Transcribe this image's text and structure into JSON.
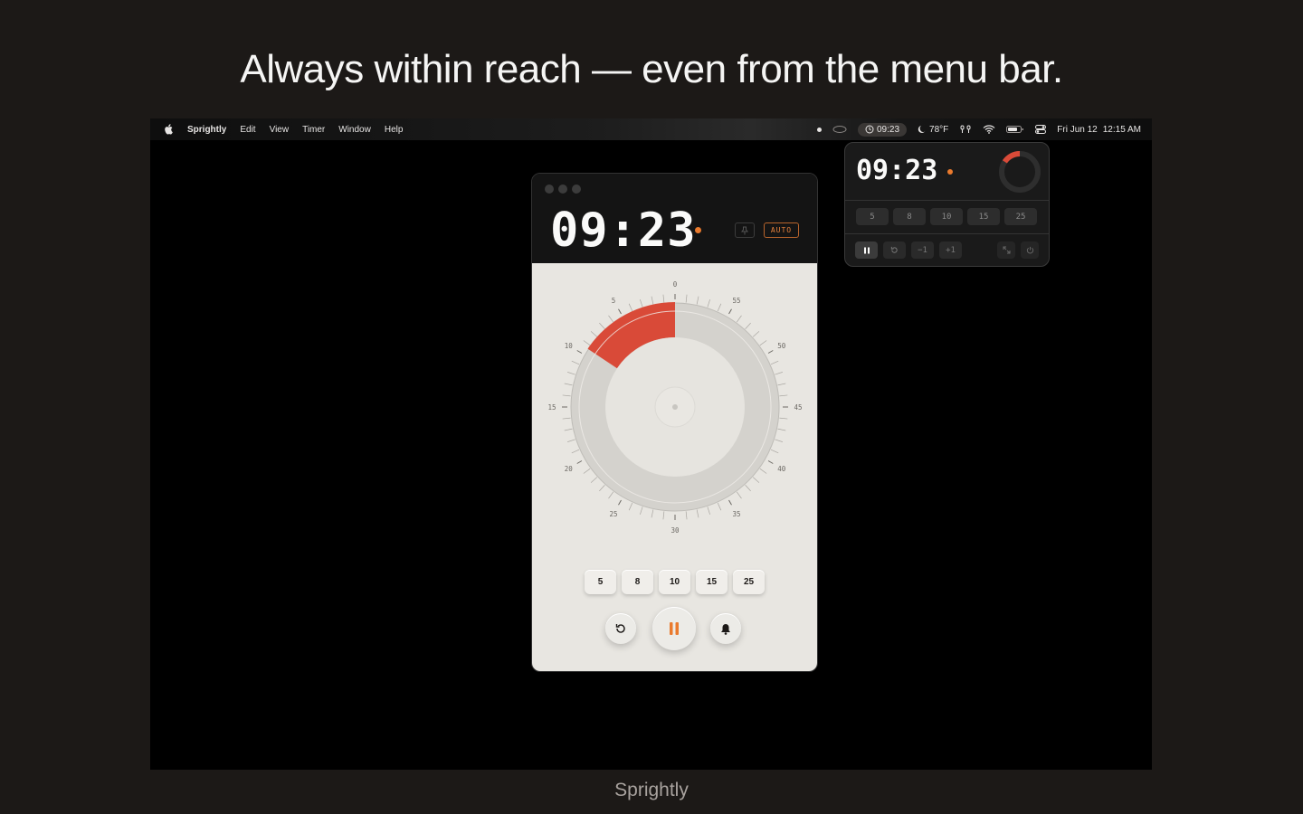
{
  "headline": "Always within reach — even from the menu bar.",
  "footer_label": "Sprightly",
  "menubar": {
    "app_name": "Sprightly",
    "menus": [
      "Edit",
      "View",
      "Timer",
      "Window",
      "Help"
    ],
    "timer": "09:23",
    "weather": "78°F",
    "date": "Fri Jun 12",
    "time": "12:15 AM"
  },
  "popover": {
    "time": "09:23",
    "progress_fraction": 0.156,
    "presets": [
      "5",
      "8",
      "10",
      "15",
      "25"
    ],
    "controls": {
      "minus": "−1",
      "plus": "+1"
    }
  },
  "window": {
    "time": "09:23",
    "auto_label": "AUTO",
    "remaining_minutes": 9.38,
    "dial_labels": [
      "0",
      "5",
      "10",
      "15",
      "20",
      "25",
      "30",
      "35",
      "40",
      "45",
      "50",
      "55"
    ],
    "presets": [
      "5",
      "8",
      "10",
      "15",
      "25"
    ]
  },
  "colors": {
    "accent_orange": "#ea7a2d",
    "dial_red": "#d94a38"
  }
}
